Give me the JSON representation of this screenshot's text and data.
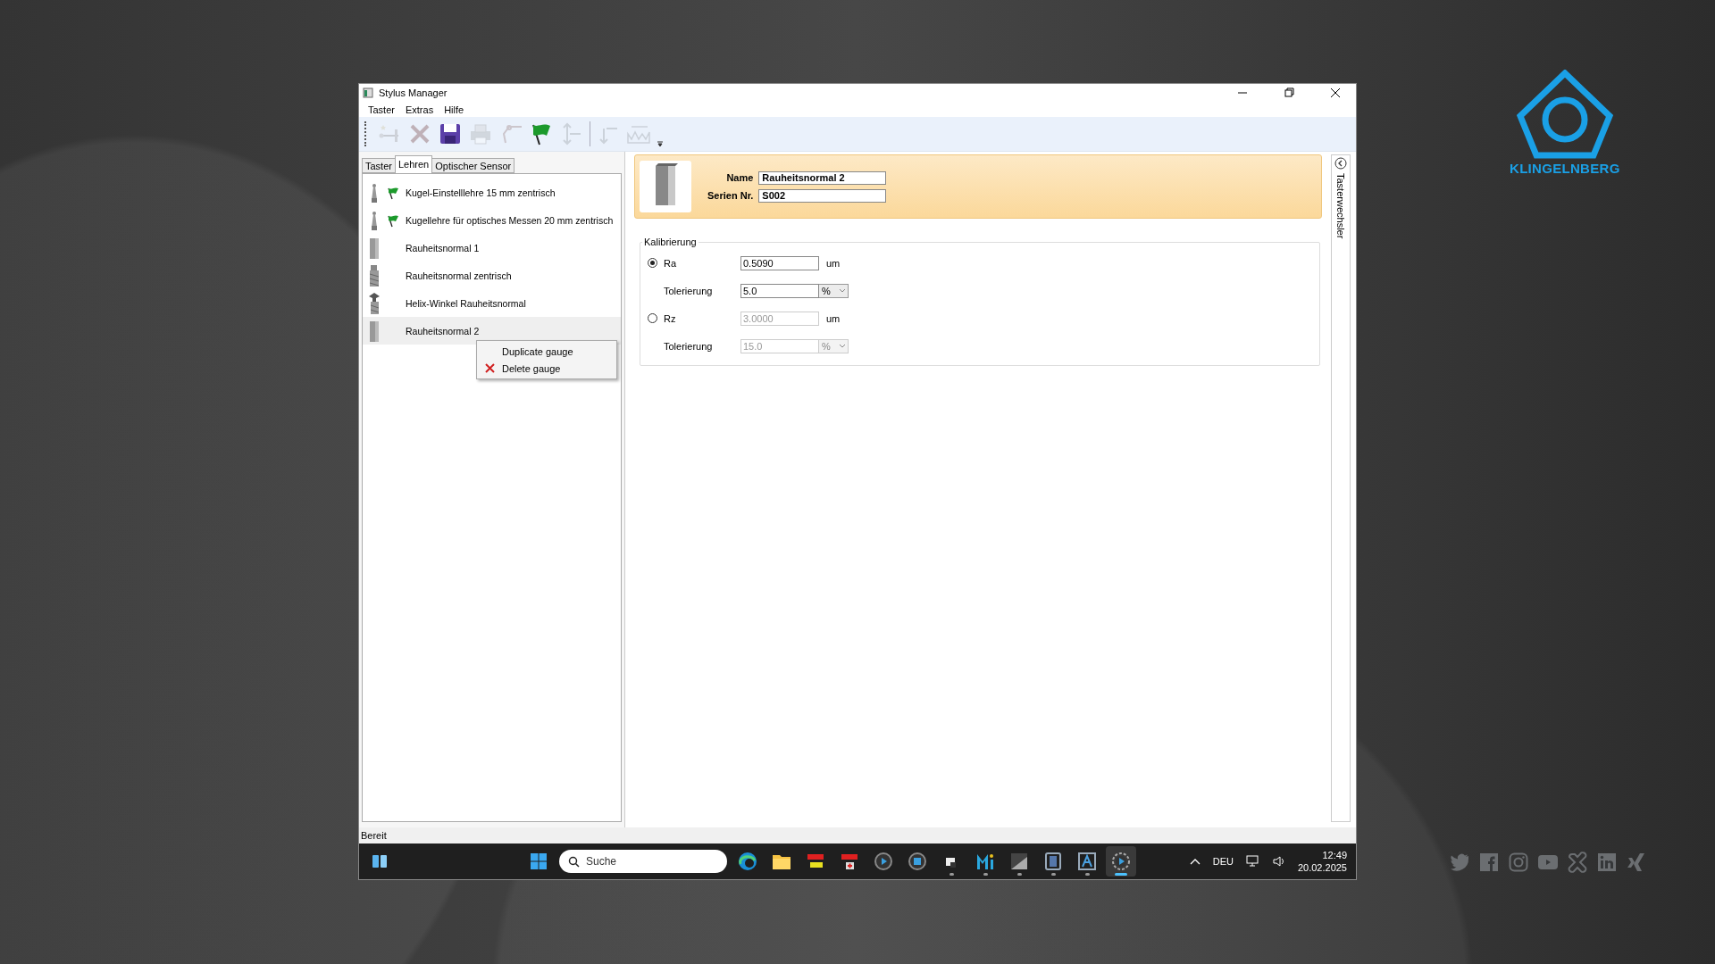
{
  "window": {
    "title": "Stylus Manager"
  },
  "menu": [
    {
      "label": "Taster"
    },
    {
      "label": "Extras"
    },
    {
      "label": "Hilfe"
    }
  ],
  "toolbar": [
    {
      "kind": "new-stylus",
      "disabled": true
    },
    {
      "kind": "delete",
      "disabled": true
    },
    {
      "kind": "save",
      "disabled": false
    },
    {
      "kind": "print",
      "disabled": true
    },
    {
      "kind": "arm",
      "disabled": true
    },
    {
      "kind": "flag",
      "disabled": false
    },
    {
      "kind": "updown",
      "disabled": true
    },
    {
      "kind": "separator"
    },
    {
      "kind": "down",
      "disabled": true
    },
    {
      "kind": "wave",
      "disabled": true
    }
  ],
  "tabs": [
    {
      "label": "Taster",
      "selected": false
    },
    {
      "label": "Lehren",
      "selected": true
    },
    {
      "label": "Optischer Sensor",
      "selected": false
    }
  ],
  "gauges": [
    {
      "name": "Kugel-Einstelllehre 15 mm zentrisch",
      "kind": "ball",
      "flagged": true,
      "selected": false
    },
    {
      "name": "Kugellehre für optisches Messen 20 mm zentrisch",
      "kind": "ball",
      "flagged": true,
      "selected": false
    },
    {
      "name": "Rauheitsnormal 1",
      "kind": "block",
      "flagged": false,
      "selected": false
    },
    {
      "name": "Rauheitsnormal zentrisch",
      "kind": "threaded",
      "flagged": false,
      "selected": false
    },
    {
      "name": "Helix-Winkel Rauheitsnormal",
      "kind": "helix",
      "flagged": false,
      "selected": false
    },
    {
      "name": "Rauheitsnormal 2",
      "kind": "block",
      "flagged": false,
      "selected": true
    }
  ],
  "context_menu": {
    "items": [
      {
        "label": "Duplicate gauge",
        "kind": "plain"
      },
      {
        "label": "Delete gauge",
        "kind": "delete"
      }
    ]
  },
  "details": {
    "name_label": "Name",
    "name": "Rauheitsnormal 2",
    "serial_label": "Serien Nr.",
    "serial": "S002"
  },
  "calibration": {
    "title": "Kalibrierung",
    "params": [
      {
        "label": "Ra",
        "selected": true,
        "disabled": false,
        "value": "0.5090",
        "unit": "um",
        "tolerance_label": "Tolerierung",
        "tolerance": "5.0",
        "tolerance_unit": "%"
      },
      {
        "label": "Rz",
        "selected": false,
        "disabled": true,
        "value": "3.0000",
        "unit": "um",
        "tolerance_label": "Tolerierung",
        "tolerance": "15.0",
        "tolerance_unit": "%"
      }
    ]
  },
  "side_panel": {
    "title": "Tasterwechsler"
  },
  "status_bar": "Bereit",
  "taskbar": {
    "search_placeholder": "Suche",
    "apps": [
      {
        "kind": "edge",
        "running": false,
        "selected": false
      },
      {
        "kind": "folder",
        "running": false,
        "selected": false
      },
      {
        "kind": "lmd",
        "running": false,
        "selected": false
      },
      {
        "kind": "lmd2",
        "running": false,
        "selected": false
      },
      {
        "kind": "play",
        "running": false,
        "selected": false
      },
      {
        "kind": "stop",
        "running": false,
        "selected": false
      },
      {
        "kind": "files",
        "running": true,
        "selected": false
      },
      {
        "kind": "m",
        "running": true,
        "selected": false
      },
      {
        "kind": "htb",
        "running": true,
        "selected": false
      },
      {
        "kind": "disk",
        "running": true,
        "selected": false
      },
      {
        "kind": "a",
        "running": true,
        "selected": false
      },
      {
        "kind": "gear",
        "running": true,
        "selected": true
      }
    ],
    "language": "DEU",
    "time": "12:49",
    "date": "20.02.2025"
  },
  "brand": {
    "name": "KLINGELNBERG"
  }
}
